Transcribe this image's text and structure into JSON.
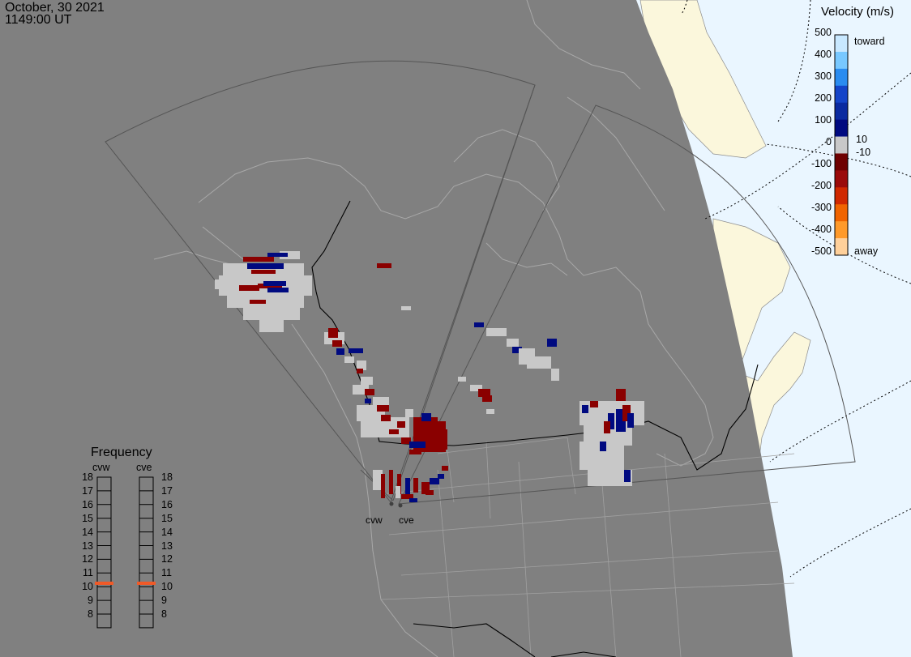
{
  "header": {
    "date": "October, 30 2021",
    "time": "1149:00 UT"
  },
  "velocity_scale": {
    "title": "Velocity (m/s)",
    "ticks": [
      "500",
      "400",
      "300",
      "200",
      "100",
      "0",
      "-100",
      "-200",
      "-300",
      "-400",
      "-500"
    ],
    "near_zero_pos": "10",
    "near_zero_neg": "-10",
    "toward_label": "toward",
    "away_label": "away",
    "colors": [
      "#c8e8ff",
      "#78c8ff",
      "#2a8cf0",
      "#1444c8",
      "#0a2aa0",
      "#000a80",
      "#c8c8c8",
      "#6e0000",
      "#9a0a0a",
      "#d02800",
      "#f06400",
      "#ff9a2a",
      "#ffd09a"
    ]
  },
  "frequency_panel": {
    "title": "Frequency",
    "radars": [
      "cvw",
      "cve"
    ],
    "ticks": [
      "18",
      "17",
      "16",
      "15",
      "14",
      "13",
      "12",
      "11",
      "10",
      "9",
      "8"
    ],
    "selected_value": 11,
    "indicator_color": "#f05a28"
  },
  "radars": [
    {
      "code": "cvw"
    },
    {
      "code": "cve"
    }
  ],
  "colors": {
    "sea_night": "#808080",
    "ocean_day": "#eaf6ff",
    "land_day": "#fbf7dc",
    "ground_scatter": "#c8c8c8",
    "toward_dark": "#000a80",
    "away_dark": "#8a0000"
  }
}
